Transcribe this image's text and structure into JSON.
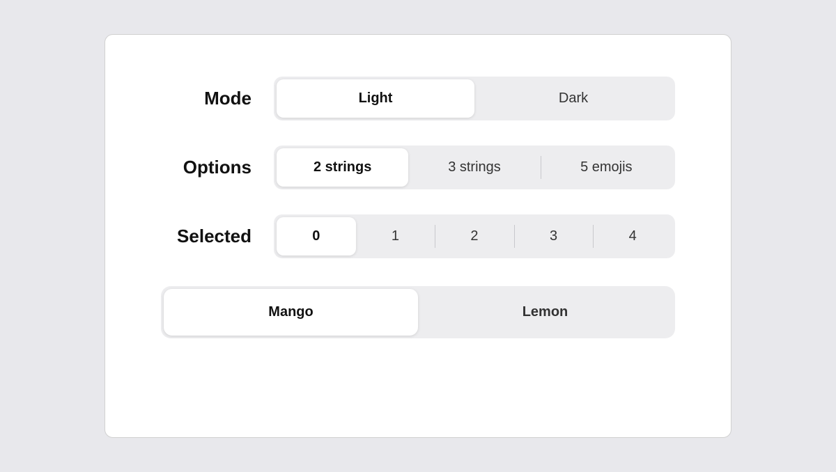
{
  "card": {
    "rows": [
      {
        "id": "mode",
        "label": "Mode",
        "options": [
          {
            "id": "light",
            "label": "Light",
            "active": true
          },
          {
            "id": "dark",
            "label": "Dark",
            "active": false
          }
        ]
      },
      {
        "id": "options",
        "label": "Options",
        "options": [
          {
            "id": "2strings",
            "label": "2 strings",
            "active": true
          },
          {
            "id": "3strings",
            "label": "3 strings",
            "active": false
          },
          {
            "id": "5emojis",
            "label": "5 emojis",
            "active": false
          }
        ]
      },
      {
        "id": "selected",
        "label": "Selected",
        "options": [
          {
            "id": "sel0",
            "label": "0",
            "active": true
          },
          {
            "id": "sel1",
            "label": "1",
            "active": false
          },
          {
            "id": "sel2",
            "label": "2",
            "active": false
          },
          {
            "id": "sel3",
            "label": "3",
            "active": false
          },
          {
            "id": "sel4",
            "label": "4",
            "active": false
          }
        ]
      }
    ],
    "bottom_options": [
      {
        "id": "mango",
        "label": "Mango",
        "active": true
      },
      {
        "id": "lemon",
        "label": "Lemon",
        "active": false
      }
    ]
  }
}
